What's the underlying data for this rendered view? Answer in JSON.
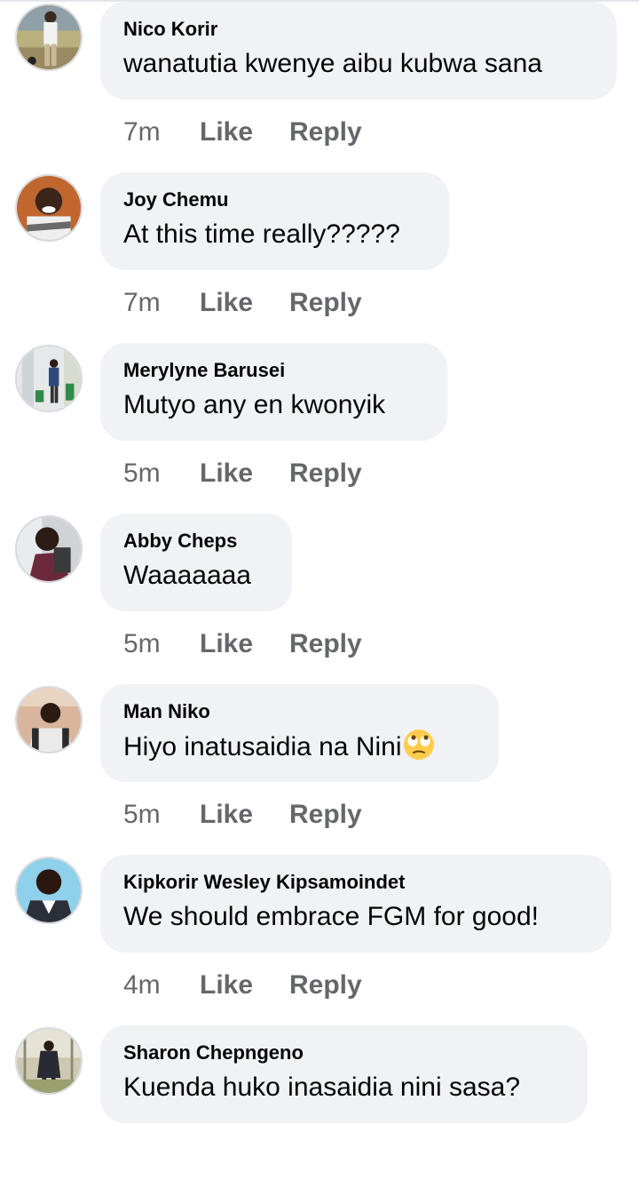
{
  "comments": [
    {
      "author": "Nico Korir",
      "text": "wanatutia kwenye aibu kubwa sana",
      "time": "7m",
      "like": "Like",
      "reply": "Reply"
    },
    {
      "author": "Joy Chemu",
      "text": "At this time really?????",
      "time": "7m",
      "like": "Like",
      "reply": "Reply"
    },
    {
      "author": "Merylyne Barusei",
      "text": "Mutyo any en kwonyik",
      "time": "5m",
      "like": "Like",
      "reply": "Reply"
    },
    {
      "author": "Abby Cheps",
      "text": "Waaaaaaa",
      "time": "5m",
      "like": "Like",
      "reply": "Reply"
    },
    {
      "author": "Man Niko",
      "text": "Hiyo inatusaidia na Nini",
      "emoji": "face-with-rolling-eyes-icon",
      "time": "5m",
      "like": "Like",
      "reply": "Reply"
    },
    {
      "author": "Kipkorir Wesley Kipsamoindet",
      "text": "We should embrace FGM for good!",
      "time": "4m",
      "like": "Like",
      "reply": "Reply"
    },
    {
      "author": "Sharon Chepngeno",
      "text": "Kuenda huko inasaidia nini sasa?",
      "time": "",
      "like": "",
      "reply": ""
    }
  ],
  "colors": {
    "bubble": "#f0f2f5",
    "meta_text": "#65676b",
    "text": "#050505"
  }
}
